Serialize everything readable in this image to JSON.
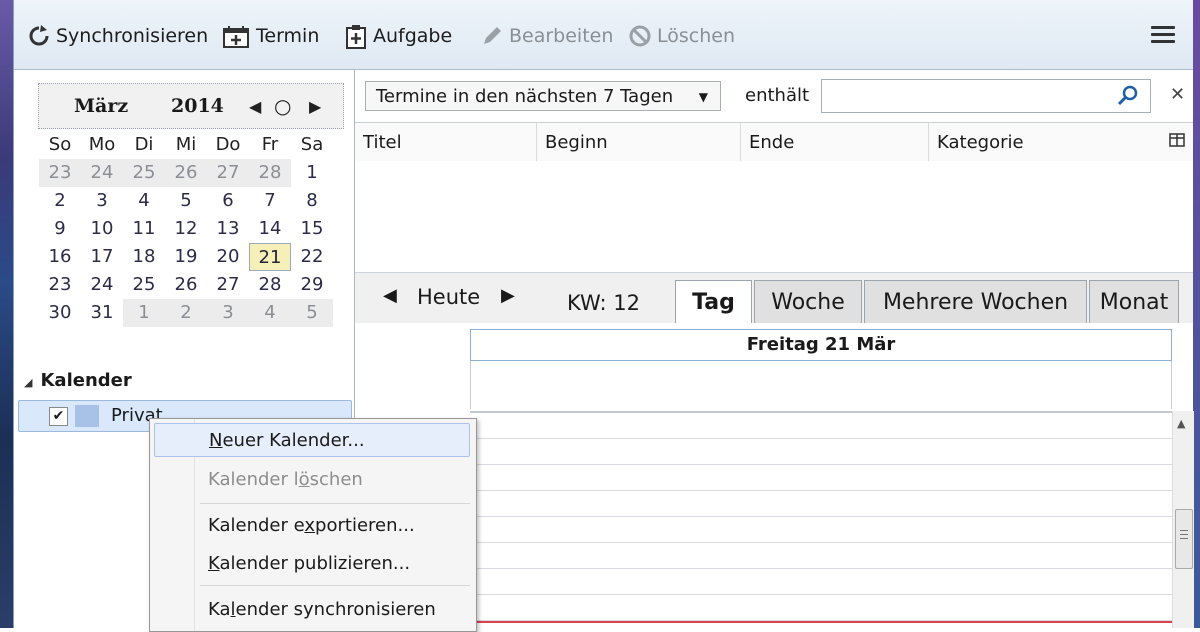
{
  "toolbar": {
    "sync_label": "Synchronisieren",
    "event_label": "Termin",
    "task_label": "Aufgabe",
    "edit_label": "Bearbeiten",
    "delete_label": "Löschen"
  },
  "minical": {
    "month": "März",
    "year": "2014",
    "weekdays": [
      "So",
      "Mo",
      "Di",
      "Mi",
      "Do",
      "Fr",
      "Sa"
    ],
    "weeks": [
      [
        "23",
        "24",
        "25",
        "26",
        "27",
        "28",
        "1"
      ],
      [
        "2",
        "3",
        "4",
        "5",
        "6",
        "7",
        "8"
      ],
      [
        "9",
        "10",
        "11",
        "12",
        "13",
        "14",
        "15"
      ],
      [
        "16",
        "17",
        "18",
        "19",
        "20",
        "21",
        "22"
      ],
      [
        "23",
        "24",
        "25",
        "26",
        "27",
        "28",
        "29"
      ],
      [
        "30",
        "31",
        "1",
        "2",
        "3",
        "4",
        "5"
      ]
    ],
    "selected_day": "21"
  },
  "calendars": {
    "header": "Kalender",
    "items": [
      {
        "label": "Privat",
        "checked": true,
        "color": "#a7c2e6"
      }
    ]
  },
  "filter": {
    "range_selected": "Termine in den nächsten 7 Tagen",
    "contains_label": "enthält",
    "search_value": ""
  },
  "list": {
    "columns": [
      "Titel",
      "Beginn",
      "Ende",
      "Kategorie"
    ]
  },
  "nav": {
    "today_label": "Heute",
    "week_label": "KW: 12",
    "tabs": [
      "Tag",
      "Woche",
      "Mehrere Wochen",
      "Monat"
    ],
    "active_tab": "Tag"
  },
  "dayview": {
    "date_header": "Freitag 21 Mär"
  },
  "context_menu": {
    "items": [
      {
        "pre": "",
        "u": "N",
        "post": "euer Kalender...",
        "enabled": true,
        "highlighted": true
      },
      {
        "pre": "Kalender l",
        "u": "ö",
        "post": "schen",
        "enabled": false
      },
      {
        "pre": "Kalender e",
        "u": "x",
        "post": "portieren...",
        "enabled": true
      },
      {
        "pre": "",
        "u": "K",
        "post": "alender publizieren...",
        "enabled": true
      },
      {
        "pre": "Ka",
        "u": "l",
        "post": "ender synchronisieren",
        "enabled": true
      }
    ]
  },
  "colors": {
    "accent_selection": "#d9e8fb",
    "today_highlight": "#f6f0b8",
    "current_time_line": "#e0404a"
  }
}
